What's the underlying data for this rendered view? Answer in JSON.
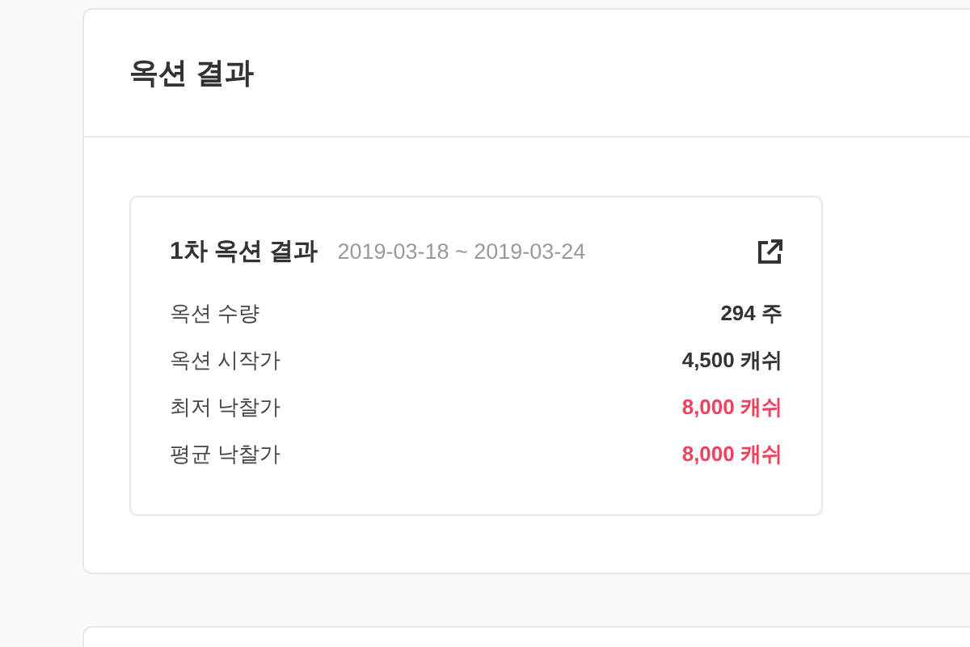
{
  "panel": {
    "title": "옥션 결과"
  },
  "result_card": {
    "title": "1차 옥션 결과",
    "period": "2019-03-18 ~ 2019-03-24",
    "rows": [
      {
        "label": "옥션 수량",
        "value": "294 주",
        "kind": "normal"
      },
      {
        "label": "옥션 시작가",
        "value": "4,500 캐쉬",
        "kind": "normal"
      },
      {
        "label": "최저 낙찰가",
        "value": "8,000 캐쉬",
        "kind": "highlight"
      },
      {
        "label": "평균 낙찰가",
        "value": "8,000 캐쉬",
        "kind": "highlight"
      }
    ]
  }
}
